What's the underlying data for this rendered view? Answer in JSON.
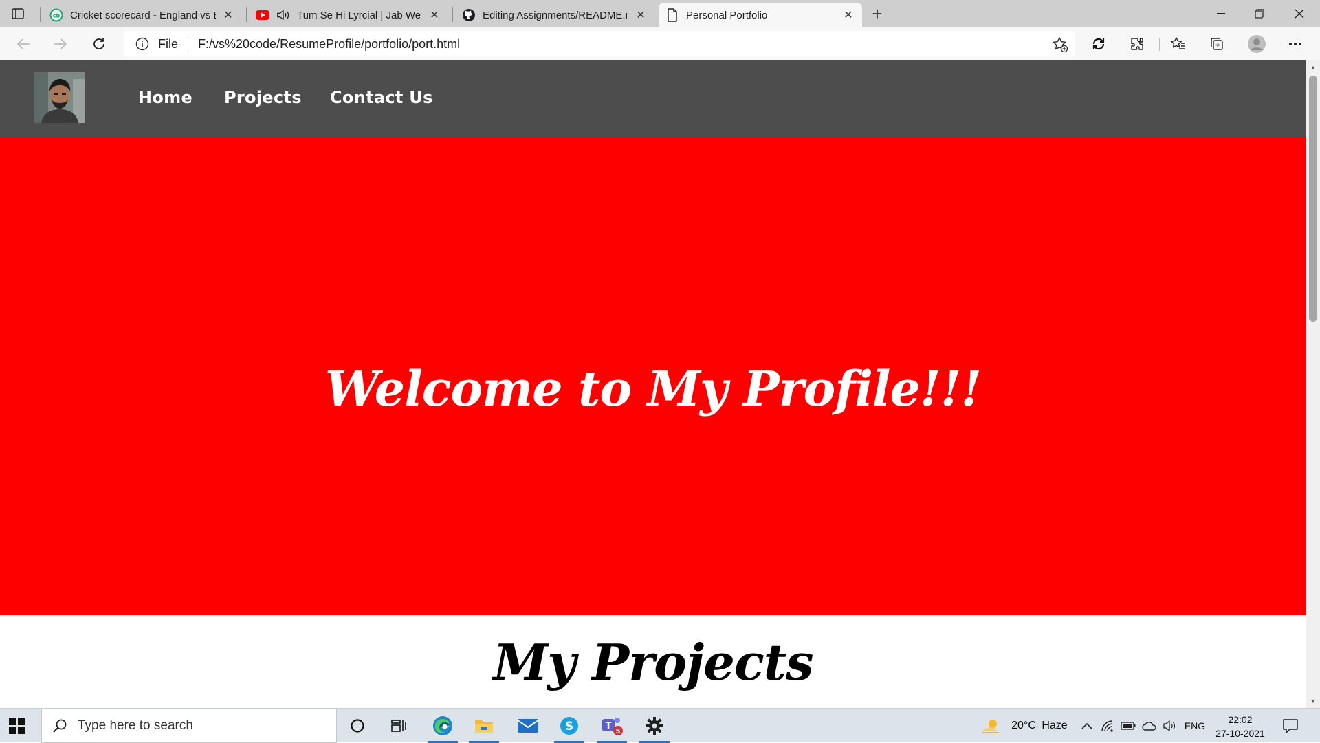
{
  "browser": {
    "tabs": [
      {
        "title": "Cricket scorecard - England vs Ba",
        "icon": "cricbuzz-icon",
        "active": false
      },
      {
        "title": "Tum Se Hi Lyrcial | Jab We M",
        "icon": "youtube-icon",
        "audio": true,
        "active": false
      },
      {
        "title": "Editing Assignments/README.m",
        "icon": "github-icon",
        "active": false
      },
      {
        "title": "Personal Portfolio",
        "icon": "page-icon",
        "active": true
      }
    ],
    "address": {
      "scheme": "File",
      "url": "F:/vs%20code/ResumeProfile/portfolio/port.html"
    }
  },
  "page": {
    "nav": {
      "links": [
        "Home",
        "Projects",
        "Contact Us"
      ]
    },
    "hero": {
      "heading": "Welcome to My Profile!!!",
      "background": "#ff0000"
    },
    "projects": {
      "heading": "My Projects"
    },
    "colors": {
      "nav_background": "#4d4d4d",
      "hero_background": "#ff0000",
      "heading_color": "#ffffff"
    }
  },
  "taskbar": {
    "search_placeholder": "Type here to search",
    "weather": {
      "temperature": "20°C",
      "condition": "Haze"
    },
    "language": "ENG",
    "clock": {
      "time": "22:02",
      "date": "27-10-2021"
    },
    "teams_badge": "5"
  }
}
